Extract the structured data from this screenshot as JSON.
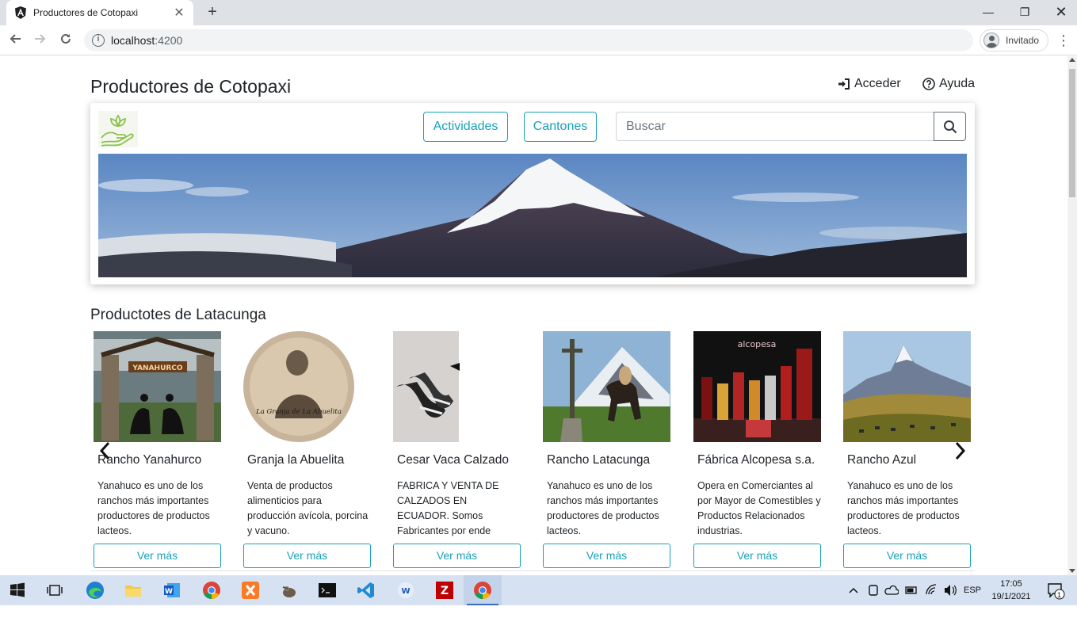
{
  "browser": {
    "tab_title": "Productores de Cotopaxi",
    "new_tab": "+",
    "url_host": "localhost",
    "url_port": ":4200",
    "profile_label": "Invitado"
  },
  "header": {
    "site_title": "Productores de Cotopaxi",
    "login_label": "Acceder",
    "help_label": "Ayuda"
  },
  "hero": {
    "activities_label": "Actividades",
    "cantons_label": "Cantones",
    "search_placeholder": "Buscar"
  },
  "section": {
    "title": "Productotes de Latacunga",
    "cards": [
      {
        "name": "Rancho Yanahurco",
        "description": "Yanahuco es uno de los ranchos más importantes productores de productos lacteos.",
        "button": "Ver más",
        "image": "ranch-gate-image",
        "sign_text": "YANAHURCO"
      },
      {
        "name": "Granja la Abuelita",
        "description": "Venta de productos alimenticios para producción avícola, porcina y vacuno.",
        "button": "Ver más",
        "image": "granja-logo-image",
        "logo_text": "La Granja de La Abuelita"
      },
      {
        "name": "Cesar Vaca Calzado",
        "description": "FABRICA Y VENTA DE CALZADOS EN ECUADOR. Somos Fabricantes por ende tenemos precios...",
        "button": "Ver más",
        "image": "shoes-image"
      },
      {
        "name": "Rancho Latacunga",
        "description": "Yanahuco es uno de los ranchos más importantes productores de productos lacteos.",
        "button": "Ver más",
        "image": "horse-rider-image"
      },
      {
        "name": "Fábrica Alcopesa s.a.",
        "description": "Opera en Comerciantes al por Mayor de Comestibles y Productos Relacionados industrias.",
        "button": "Ver más",
        "image": "liquor-bottles-image",
        "brand_text": "alcopesa"
      },
      {
        "name": "Rancho Azul",
        "description": "Yanahuco es uno de los ranchos más importantes productores de productos lacteos.",
        "button": "Ver más",
        "image": "mountain-horses-image"
      }
    ]
  },
  "taskbar": {
    "language": "ESP",
    "time": "17:05",
    "date": "19/1/2021",
    "notifications": "1"
  },
  "colors": {
    "accent": "#17a2b8",
    "taskbar": "#d6e2f2"
  }
}
